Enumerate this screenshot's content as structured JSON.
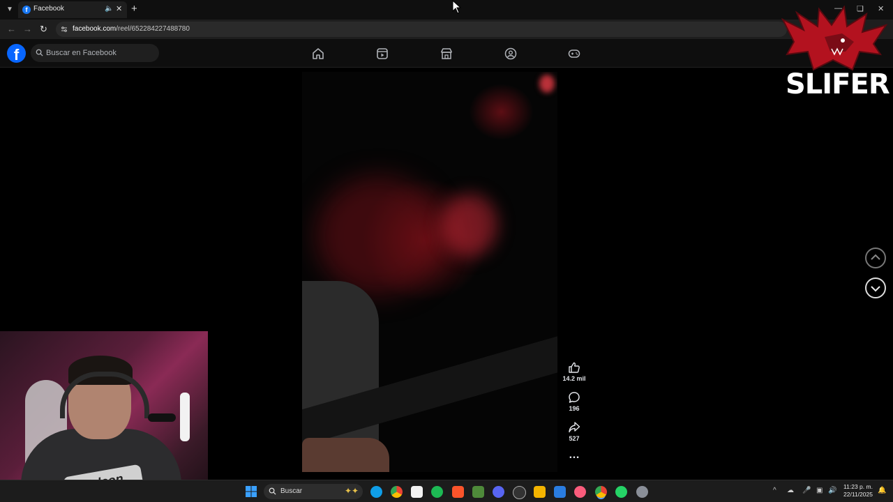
{
  "browser": {
    "tab_title": "Facebook",
    "url_host": "facebook.com",
    "url_path": "/reel/652284227488780"
  },
  "facebook": {
    "search_placeholder": "Buscar en Facebook",
    "nav_icons": [
      "home-icon",
      "video-icon",
      "marketplace-icon",
      "groups-icon",
      "gaming-icon"
    ]
  },
  "reel": {
    "likes": "14.2 mil",
    "comments": "196",
    "shares": "527"
  },
  "overlay": {
    "logo_text": "SLIFER"
  },
  "webcam": {
    "shirt_text": "Falcon"
  },
  "taskbar": {
    "search_placeholder": "Buscar",
    "time": "11:23 p. m.",
    "date": "22/11/2025"
  },
  "colors": {
    "fb_blue": "#0866ff",
    "accent_red": "#c0202f"
  }
}
